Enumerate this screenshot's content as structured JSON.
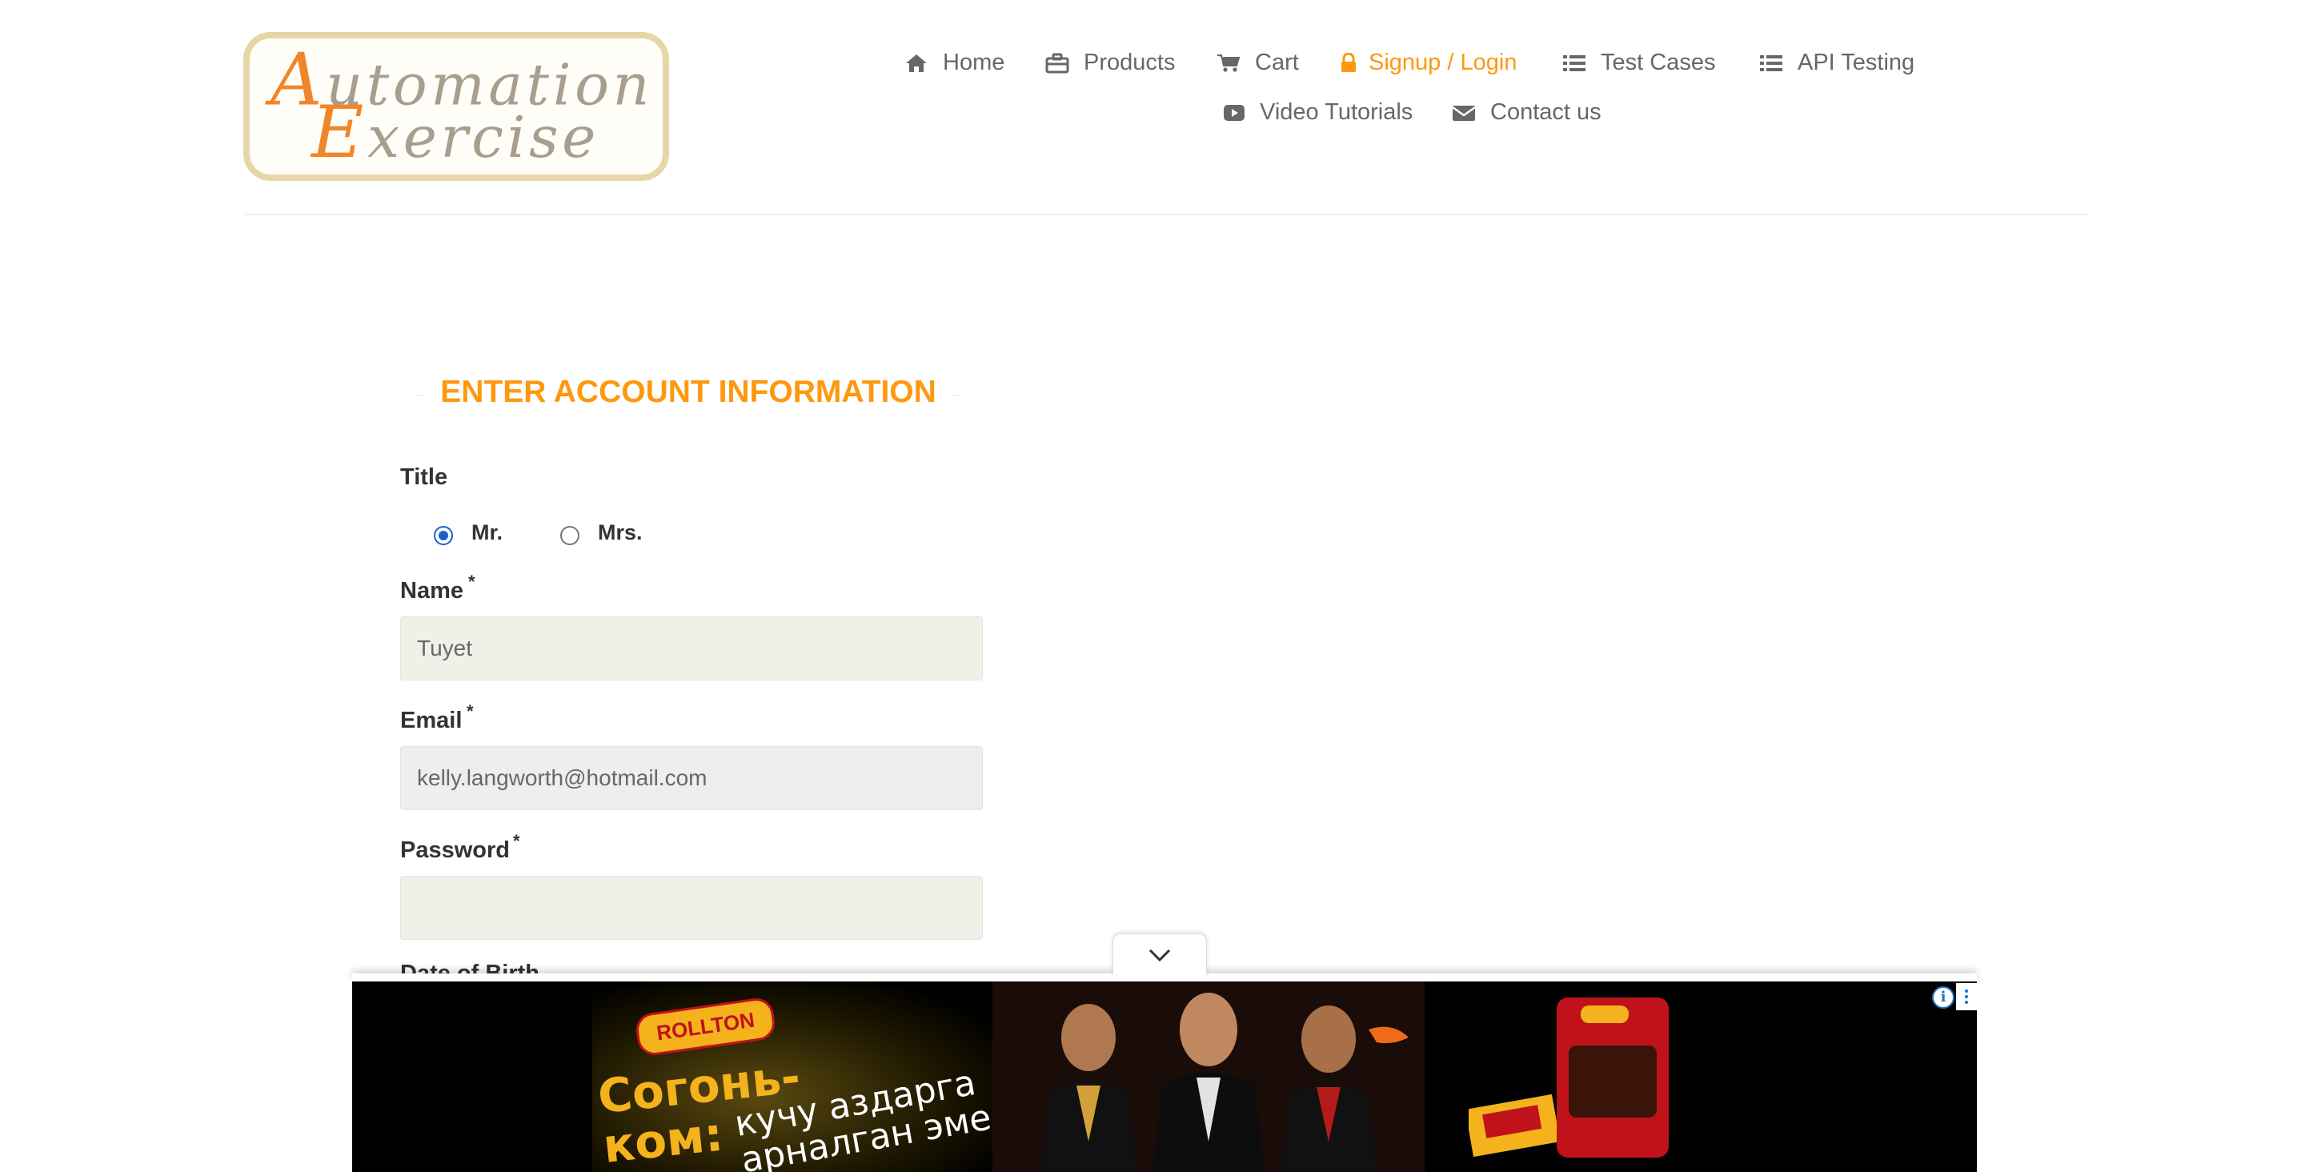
{
  "header": {
    "logo": {
      "line1": "Automation",
      "line2": "Exercise"
    },
    "nav": [
      {
        "label": "Home",
        "icon": "home-icon"
      },
      {
        "label": "Products",
        "icon": "briefcase-icon"
      },
      {
        "label": "Cart",
        "icon": "cart-icon"
      },
      {
        "label": "Signup / Login",
        "icon": "lock-icon",
        "active": true
      },
      {
        "label": "Test Cases",
        "icon": "list-icon"
      },
      {
        "label": "API Testing",
        "icon": "list-icon"
      },
      {
        "label": "Video Tutorials",
        "icon": "youtube-play-icon"
      },
      {
        "label": "Contact us",
        "icon": "envelope-icon"
      }
    ]
  },
  "form": {
    "heading": "ENTER ACCOUNT INFORMATION",
    "title_label": "Title",
    "title_options": [
      {
        "label": "Mr.",
        "checked": true
      },
      {
        "label": "Mrs.",
        "checked": false
      }
    ],
    "name_label": "Name",
    "name_value": "Tuyet",
    "email_label": "Email",
    "email_value": "kelly.langworth@hotmail.com",
    "password_label": "Password",
    "password_value": "",
    "required_mark": "*",
    "dob_label": "Date of Birth"
  },
  "ad": {
    "brand": "ROLLTON",
    "headline_line1": "Согонь-",
    "headline_line2": "ком:",
    "tagline_line1": "кучу аздарга",
    "tagline_line2": "арналган эмес!",
    "info_glyph": "i"
  },
  "colors": {
    "accent": "#fe980f",
    "text": "#696763",
    "label": "#333333",
    "input_bg": "#f0f0e9",
    "radio_checked": "#1a5fd0"
  }
}
